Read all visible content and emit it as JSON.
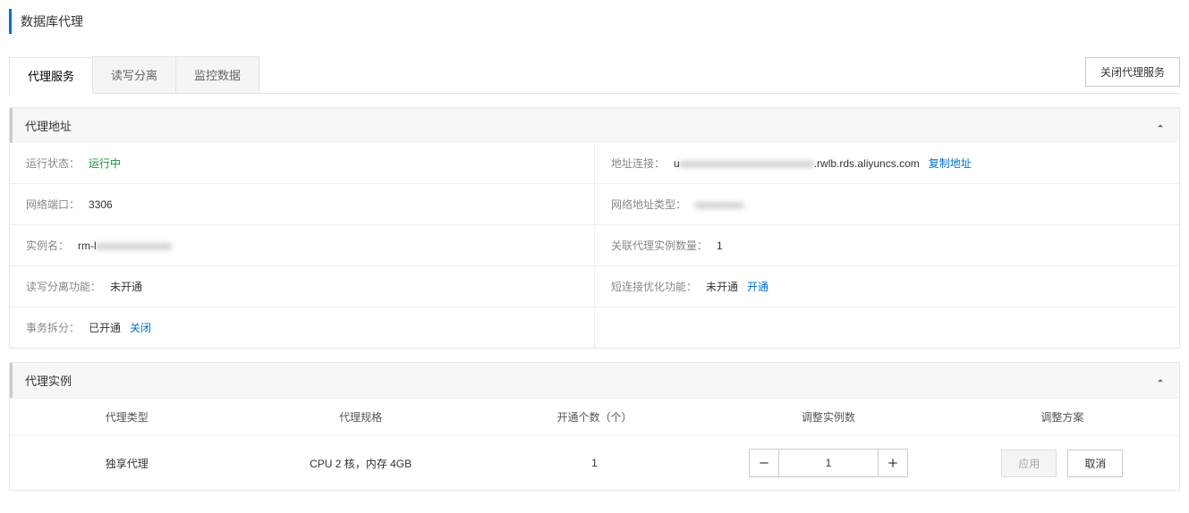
{
  "page_title": "数据库代理",
  "tabs": [
    {
      "label": "代理服务",
      "active": true
    },
    {
      "label": "读写分离",
      "active": false
    },
    {
      "label": "监控数据",
      "active": false
    }
  ],
  "close_proxy_button": "关闭代理服务",
  "panel_address": {
    "title": "代理地址",
    "rows": {
      "status_label": "运行状态：",
      "status_value": "运行中",
      "addr_label": "地址连接：",
      "addr_prefix": "u",
      "addr_hidden": "xxxxxxxxxxxxxxxxxxxxxxxxx",
      "addr_suffix": ".rwlb.rds.aliyuncs.com",
      "copy_link": "复制地址",
      "port_label": "网络端口：",
      "port_value": "3306",
      "net_type_label": "网络地址类型：",
      "net_type_value": "xxxxxxxxx",
      "instance_label": "实例名：",
      "instance_prefix": "rm-l",
      "instance_hidden": "xxxxxxxxxxxxxx",
      "assoc_count_label": "关联代理实例数量：",
      "assoc_count_value": "1",
      "rw_split_label": "读写分离功能：",
      "rw_split_value": "未开通",
      "short_conn_label": "短连接优化功能：",
      "short_conn_value": "未开通",
      "short_conn_link": "开通",
      "tx_split_label": "事务拆分：",
      "tx_split_value": "已开通",
      "tx_split_link": "关闭"
    }
  },
  "panel_instance": {
    "title": "代理实例",
    "columns": {
      "type": "代理类型",
      "spec": "代理规格",
      "count": "开通个数（个）",
      "adjust": "调整实例数",
      "plan": "调整方案"
    },
    "row": {
      "type": "独享代理",
      "spec": "CPU 2 核，内存 4GB",
      "count": "1",
      "adjust_value": "1",
      "apply": "应用",
      "cancel": "取消"
    }
  }
}
